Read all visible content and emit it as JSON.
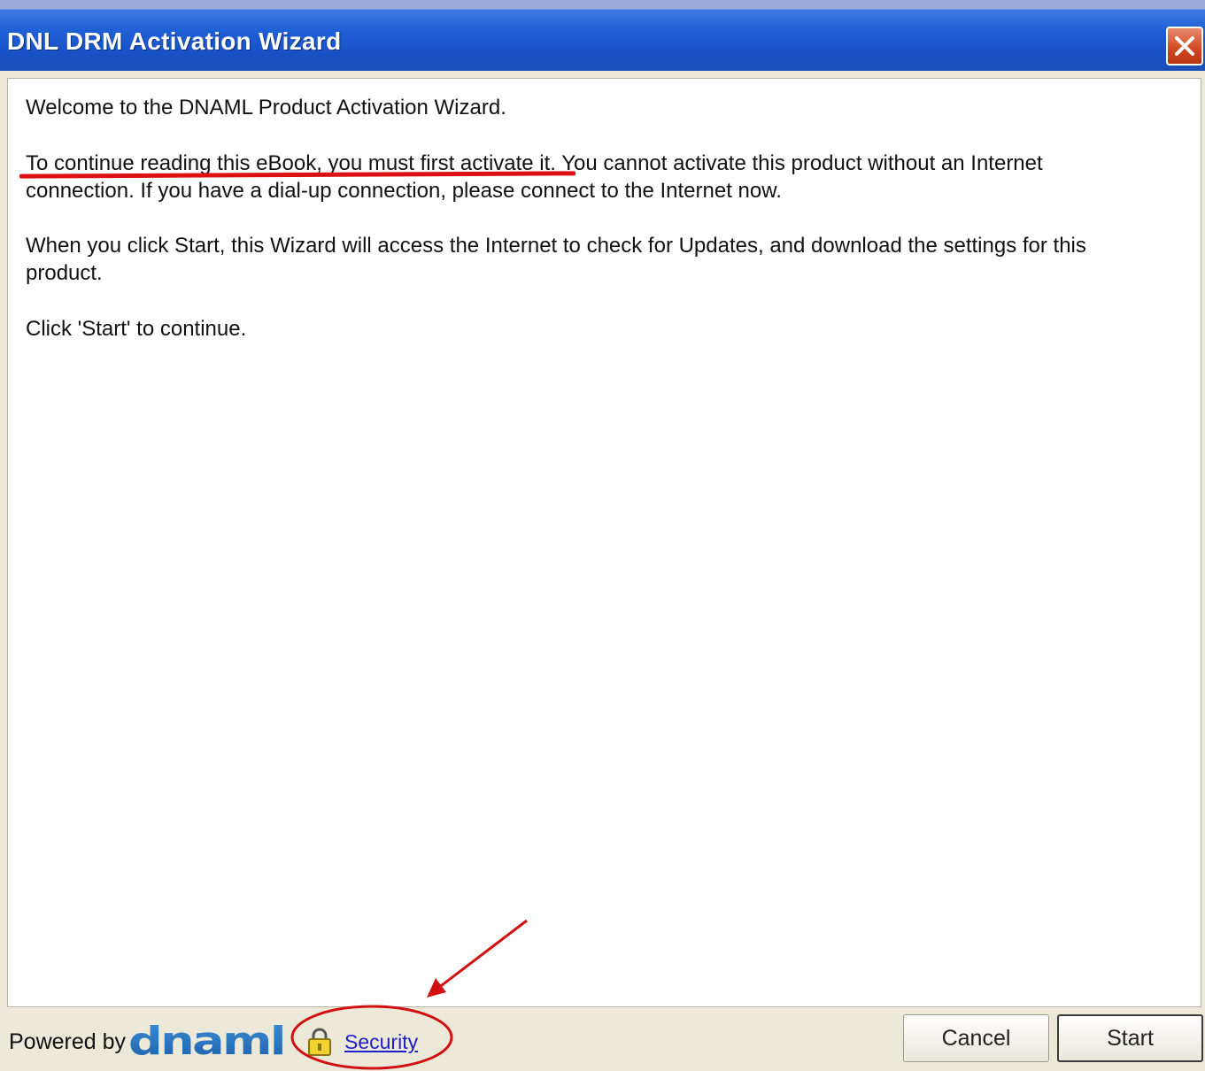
{
  "window": {
    "title": "DNL DRM Activation Wizard",
    "close_icon": "close-icon"
  },
  "body": {
    "welcome": "Welcome to the DNAML Product Activation Wizard.",
    "notice": "To continue reading this eBook, you must first activate it. You cannot activate this product without an Internet connection.  If you have a dial-up connection, please connect to the Internet now.",
    "info": "When you click Start, this Wizard will access the Internet to check for Updates, and download the settings for this product.",
    "instruction": "Click 'Start' to continue."
  },
  "footer": {
    "powered_by": "Powered by",
    "logo_text": "dnaml",
    "security_label": "Security",
    "lock_icon": "lock-icon",
    "cancel_label": "Cancel",
    "start_label": "Start"
  },
  "annotations": {
    "color": "#d11111",
    "underline": "red-underline",
    "circle": "red-ellipse",
    "arrow": "red-arrow"
  }
}
